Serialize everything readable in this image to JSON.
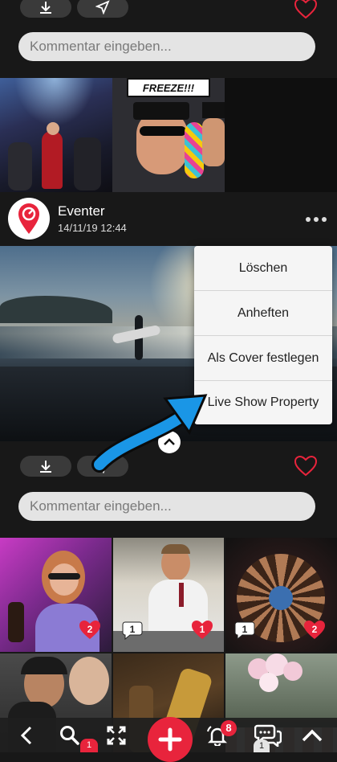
{
  "post_top": {
    "comment_placeholder": "Kommentar eingeben...",
    "download_icon": "download-icon",
    "share_icon": "send-icon",
    "like_icon": "heart-outline-icon"
  },
  "post": {
    "author": "Eventer",
    "timestamp": "14/11/19 12:44",
    "more_icon": "more-horizontal-icon",
    "comment_placeholder": "Kommentar eingeben..."
  },
  "context_menu": {
    "items": [
      {
        "label": "Löschen"
      },
      {
        "label": "Anheften"
      },
      {
        "label": "Als Cover festlegen"
      },
      {
        "label": "Live Show Property"
      }
    ]
  },
  "party_photo_text": "FREEZE!!!",
  "grid": {
    "tiles": [
      {
        "likes": "2",
        "comments": ""
      },
      {
        "likes": "1",
        "comments": "1"
      },
      {
        "likes": "2",
        "comments": "1"
      }
    ]
  },
  "bottom_nav": {
    "notification_count": "8",
    "search_badge": "1",
    "chat_badge": "1",
    "icons": [
      "back-icon",
      "search-icon",
      "fullscreen-icon",
      "add-icon",
      "notification-icon",
      "chat-icon",
      "up-icon"
    ]
  },
  "colors": {
    "accent_red": "#e8243c",
    "arrow_blue": "#1a96e6",
    "background": "#181818"
  }
}
